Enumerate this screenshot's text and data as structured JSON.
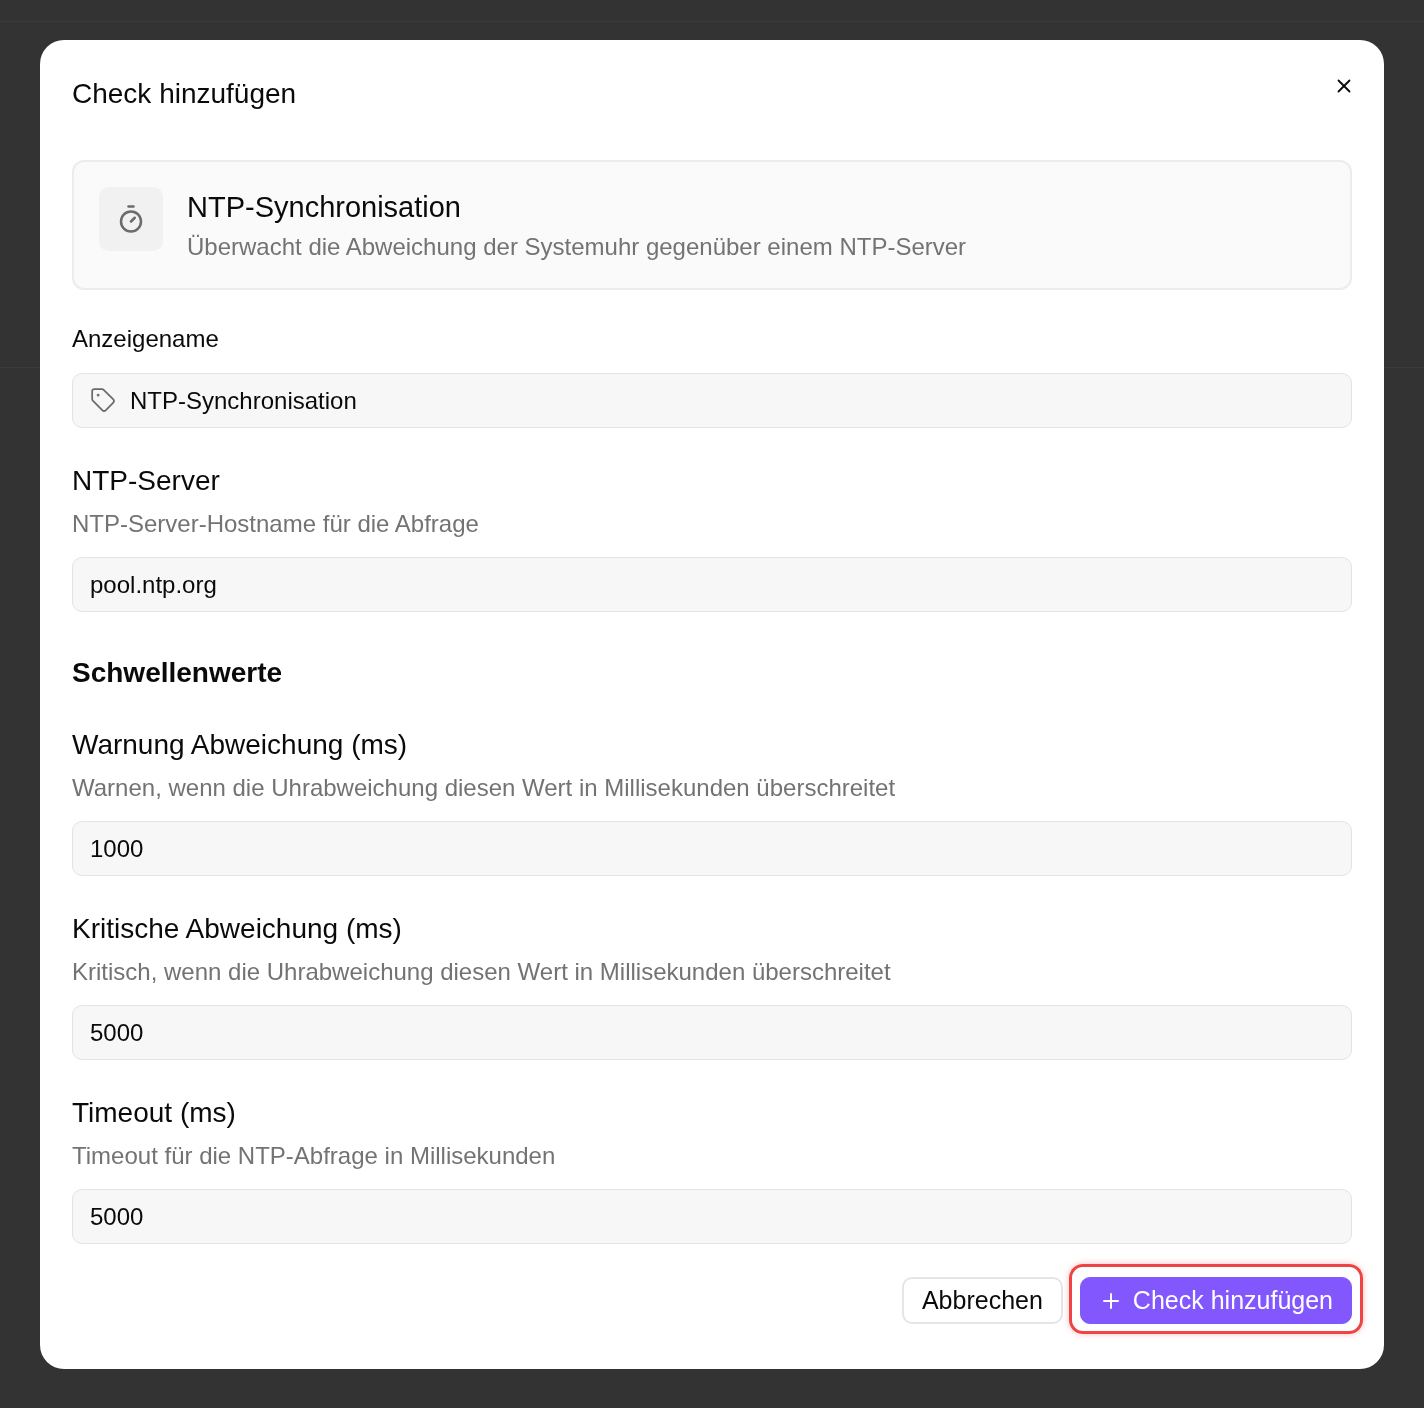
{
  "dialog": {
    "title": "Check hinzufügen"
  },
  "check_type": {
    "name": "NTP-Synchronisation",
    "description": "Überwacht die Abweichung der Systemuhr gegenüber einem NTP-Server"
  },
  "form": [
    {
      "kind": "name_field",
      "label": "Anzeigename",
      "value": "NTP-Synchronisation"
    },
    {
      "kind": "field",
      "label": "NTP-Server",
      "description": "NTP-Server-Hostname für die Abfrage",
      "value": "pool.ntp.org"
    },
    {
      "kind": "heading",
      "title": "Schwellenwerte"
    },
    {
      "kind": "field",
      "label": "Warnung Abweichung (ms)",
      "description": "Warnen, wenn die Uhrabweichung diesen Wert in Millisekunden überschreitet",
      "value": "1000"
    },
    {
      "kind": "field",
      "label": "Kritische Abweichung (ms)",
      "description": "Kritisch, wenn die Uhrabweichung diesen Wert in Millisekunden überschreitet",
      "value": "5000"
    },
    {
      "kind": "field",
      "label": "Timeout (ms)",
      "description": "Timeout für die NTP-Abfrage in Millisekunden",
      "value": "5000"
    }
  ],
  "buttons": [
    {
      "kind": "secondary",
      "label": "Abbrechen",
      "focused": false
    },
    {
      "kind": "primary",
      "label": "Check hinzufügen",
      "focused": true
    }
  ]
}
